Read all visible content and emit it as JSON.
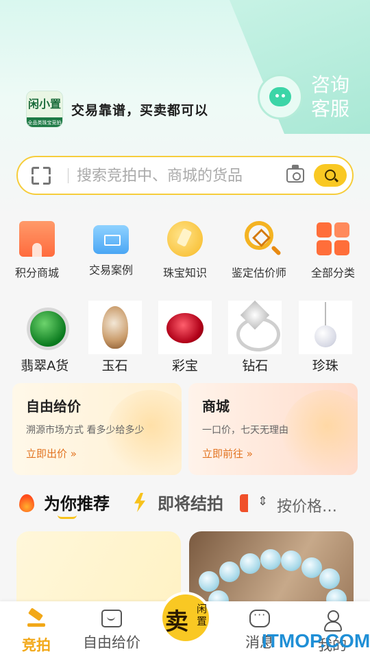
{
  "header": {
    "logo_text": "闲小置",
    "logo_subtext": "全品类珠宝竞拍",
    "slogan": "交易靠谱，买卖都可以",
    "service_label": "咨询客服"
  },
  "search": {
    "placeholder": "搜索竞拍中、商城的货品"
  },
  "quick_nav": [
    {
      "label": "积分商城",
      "icon": "shop-icon"
    },
    {
      "label": "交易案例",
      "icon": "briefcase-icon"
    },
    {
      "label": "珠宝知识",
      "icon": "jewel-tag-icon"
    },
    {
      "label": "鉴定估价师",
      "icon": "magnifier-appraise-icon"
    },
    {
      "label": "全部分类",
      "icon": "grid-categories-icon"
    }
  ],
  "categories": [
    {
      "label": "翡翠A货"
    },
    {
      "label": "玉石"
    },
    {
      "label": "彩宝"
    },
    {
      "label": "钻石"
    },
    {
      "label": "珍珠"
    }
  ],
  "promo_cards": {
    "free_price": {
      "title": "自由给价",
      "desc": "溯源市场方式 看多少给多少",
      "link": "立即出价 »"
    },
    "mall": {
      "title": "商城",
      "desc": "一口价，七天无理由",
      "link": "立即前往 »"
    }
  },
  "feed_tabs": {
    "recommend": "为你推荐",
    "ending": "即将结拍",
    "price_sort": "按价格…"
  },
  "bottom_nav": {
    "auction": "竞拍",
    "free_price": "自由给价",
    "sell_main": "卖",
    "sell_sub": "闲置",
    "messages": "消息",
    "mine": "我的"
  },
  "watermark": "ITMOP.COM",
  "colors": {
    "accent": "#f9c823",
    "active_nav": "#f2a818",
    "link": "#e27320"
  }
}
